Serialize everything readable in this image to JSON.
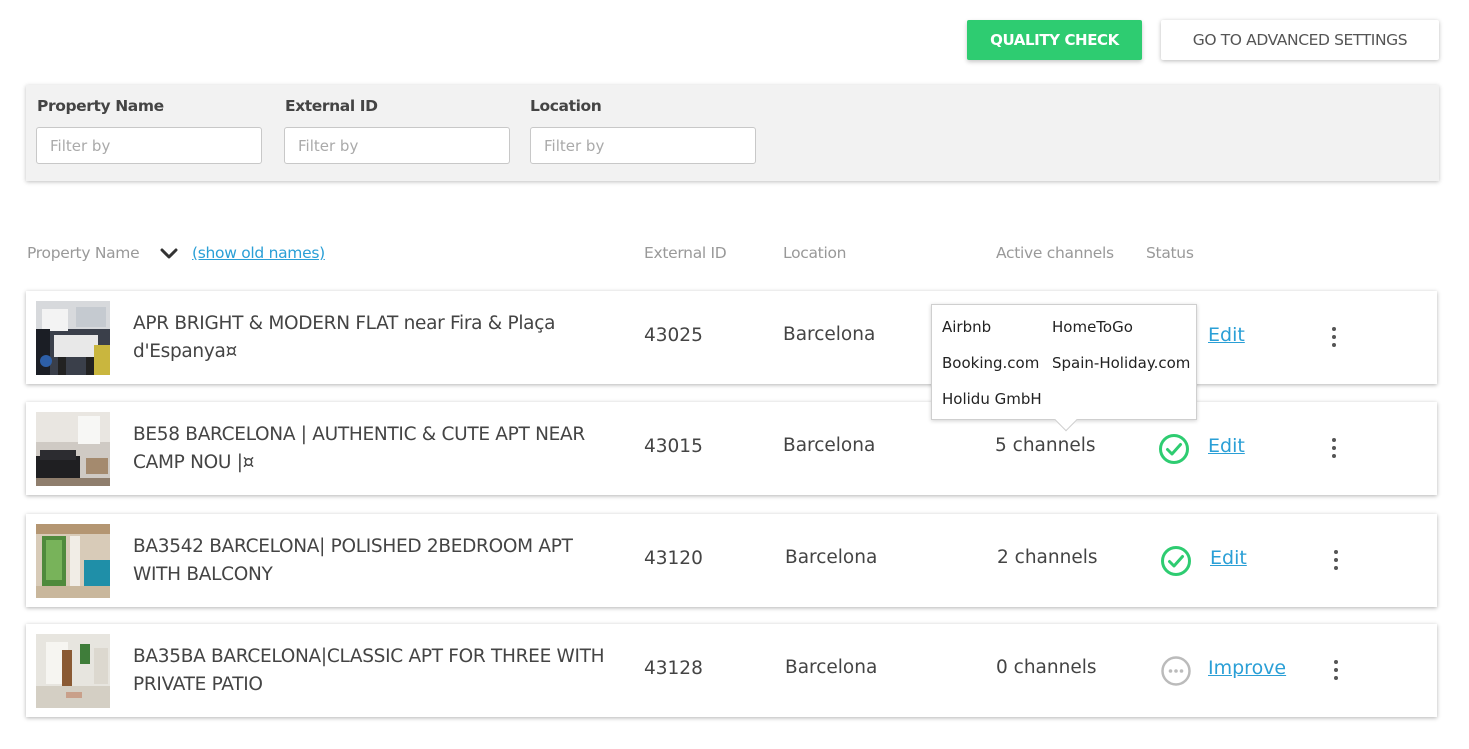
{
  "toolbar": {
    "quality_check_label": "QUALITY CHECK",
    "advanced_settings_label": "GO TO ADVANCED SETTINGS"
  },
  "filters": [
    {
      "label": "Property Name",
      "placeholder": "Filter by",
      "value": ""
    },
    {
      "label": "External ID",
      "placeholder": "Filter by",
      "value": ""
    },
    {
      "label": "Location",
      "placeholder": "Filter by",
      "value": ""
    }
  ],
  "table": {
    "headers": {
      "property_name": "Property Name",
      "show_old_names": "(show old names)",
      "external_id": "External ID",
      "location": "Location",
      "active_channels": "Active channels",
      "status": "Status"
    },
    "rows": [
      {
        "name": "APR BRIGHT & MODERN FLAT near Fira & Plaça d'Espanya¤",
        "external_id": "43025",
        "location": "Barcelona",
        "channels": "",
        "status": "",
        "action": "Edit"
      },
      {
        "name": "BE58 BARCELONA | AUTHENTIC & CUTE APT NEAR CAMP NOU |¤",
        "external_id": "43015",
        "location": "Barcelona",
        "channels": "5 channels",
        "status": "check-icon",
        "action": "Edit"
      },
      {
        "name": "BA3542 BARCELONA| POLISHED 2BEDROOM APT WITH BALCONY",
        "external_id": "43120",
        "location": "Barcelona",
        "channels": "2 channels",
        "status": "check-icon",
        "action": "Edit"
      },
      {
        "name": "BA35BA BARCELONA|CLASSIC APT FOR THREE WITH PRIVATE PATIO",
        "external_id": "43128",
        "location": "Barcelona",
        "channels": "0 channels",
        "status": "pending-icon",
        "action": "Improve"
      }
    ]
  },
  "channels_tooltip": {
    "items": [
      "Airbnb",
      "HomeToGo",
      "Booking.com",
      "Spain-Holiday.com",
      "Holidu GmbH"
    ]
  },
  "colors": {
    "accent_green": "#2ecc71",
    "link_blue": "#2a9fd6",
    "status_green": "#2ecc71",
    "status_grey": "#bbbbbb"
  }
}
